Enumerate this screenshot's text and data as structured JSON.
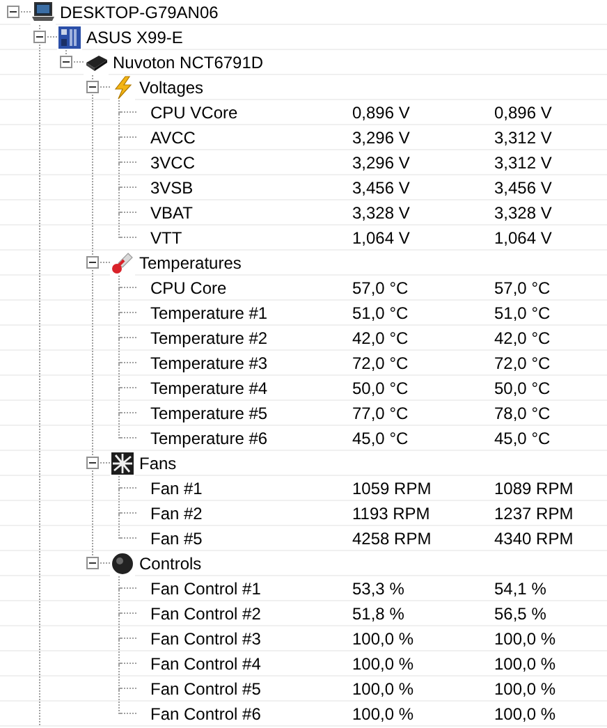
{
  "tree": [
    {
      "label": "DESKTOP-G79AN06",
      "kind": "computer",
      "expanded": true,
      "children": [
        {
          "label": "ASUS X99-E",
          "kind": "motherboard",
          "expanded": true,
          "continues": true,
          "children": [
            {
              "label": "Nuvoton NCT6791D",
              "kind": "chip",
              "expanded": true,
              "children": [
                {
                  "label": "Voltages",
                  "kind": "voltage",
                  "expanded": true,
                  "children": [
                    {
                      "label": "CPU VCore",
                      "column_2": "0,896 V",
                      "column_3": "0,896 V"
                    },
                    {
                      "label": "AVCC",
                      "column_2": "3,296 V",
                      "column_3": "3,312 V"
                    },
                    {
                      "label": "3VCC",
                      "column_2": "3,296 V",
                      "column_3": "3,312 V"
                    },
                    {
                      "label": "3VSB",
                      "column_2": "3,456 V",
                      "column_3": "3,456 V"
                    },
                    {
                      "label": "VBAT",
                      "column_2": "3,328 V",
                      "column_3": "3,328 V"
                    },
                    {
                      "label": "VTT",
                      "column_2": "1,064 V",
                      "column_3": "1,064 V"
                    }
                  ]
                },
                {
                  "label": "Temperatures",
                  "kind": "temperature",
                  "expanded": true,
                  "children": [
                    {
                      "label": "CPU Core",
                      "column_2": "57,0 °C",
                      "column_3": "57,0 °C"
                    },
                    {
                      "label": "Temperature #1",
                      "column_2": "51,0 °C",
                      "column_3": "51,0 °C"
                    },
                    {
                      "label": "Temperature #2",
                      "column_2": "42,0 °C",
                      "column_3": "42,0 °C"
                    },
                    {
                      "label": "Temperature #3",
                      "column_2": "72,0 °C",
                      "column_3": "72,0 °C"
                    },
                    {
                      "label": "Temperature #4",
                      "column_2": "50,0 °C",
                      "column_3": "50,0 °C"
                    },
                    {
                      "label": "Temperature #5",
                      "column_2": "77,0 °C",
                      "column_3": "78,0 °C"
                    },
                    {
                      "label": "Temperature #6",
                      "column_2": "45,0 °C",
                      "column_3": "45,0 °C"
                    }
                  ]
                },
                {
                  "label": "Fans",
                  "kind": "fan",
                  "expanded": true,
                  "children": [
                    {
                      "label": "Fan #1",
                      "column_2": "1059 RPM",
                      "column_3": "1089 RPM"
                    },
                    {
                      "label": "Fan #2",
                      "column_2": "1193 RPM",
                      "column_3": "1237 RPM"
                    },
                    {
                      "label": "Fan #5",
                      "column_2": "4258 RPM",
                      "column_3": "4340 RPM"
                    }
                  ]
                },
                {
                  "label": "Controls",
                  "kind": "control",
                  "expanded": true,
                  "children": [
                    {
                      "label": "Fan Control #1",
                      "column_2": "53,3 %",
                      "column_3": "54,1 %"
                    },
                    {
                      "label": "Fan Control #2",
                      "column_2": "51,8 %",
                      "column_3": "56,5 %"
                    },
                    {
                      "label": "Fan Control #3",
                      "column_2": "100,0 %",
                      "column_3": "100,0 %"
                    },
                    {
                      "label": "Fan Control #4",
                      "column_2": "100,0 %",
                      "column_3": "100,0 %"
                    },
                    {
                      "label": "Fan Control #5",
                      "column_2": "100,0 %",
                      "column_3": "100,0 %"
                    },
                    {
                      "label": "Fan Control #6",
                      "column_2": "100,0 %",
                      "column_3": "100,0 %"
                    }
                  ]
                }
              ]
            }
          ]
        }
      ]
    }
  ]
}
